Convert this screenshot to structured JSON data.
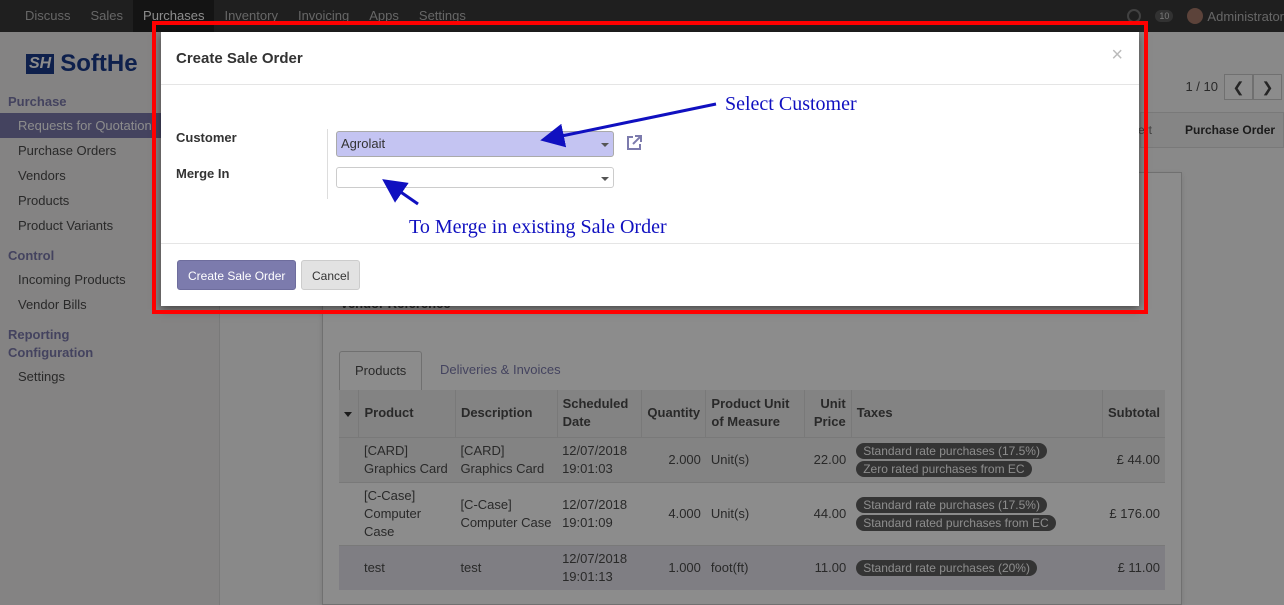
{
  "navbar": {
    "items": [
      {
        "label": "Discuss",
        "active": false
      },
      {
        "label": "Sales",
        "active": false
      },
      {
        "label": "Purchases",
        "active": true
      },
      {
        "label": "Inventory",
        "active": false
      },
      {
        "label": "Invoicing",
        "active": false
      },
      {
        "label": "Apps",
        "active": false
      },
      {
        "label": "Settings",
        "active": false
      }
    ],
    "chat_count": "10",
    "user": "Administrator"
  },
  "sidebar": {
    "logo_text": "SoftHe",
    "sections": [
      {
        "title": "Purchase",
        "items": [
          "Requests for Quotation",
          "Purchase Orders",
          "Vendors",
          "Products",
          "Product Variants"
        ]
      },
      {
        "title": "Control",
        "items": [
          "Incoming Products",
          "Vendor Bills"
        ]
      },
      {
        "title": "Reporting",
        "items": []
      },
      {
        "title": "Configuration",
        "items": [
          "Settings"
        ]
      }
    ],
    "active_item": "Requests for Quotation"
  },
  "main": {
    "pager": "1 / 10",
    "status": [
      "ert",
      "Purchase Order"
    ],
    "vendor_reference_label": "Vendor Reference",
    "tabs": [
      "Products",
      "Deliveries & Invoices"
    ],
    "table": {
      "headers": [
        "Product",
        "Description",
        "Scheduled Date",
        "Quantity",
        "Product Unit of Measure",
        "Unit Price",
        "Taxes",
        "Subtotal"
      ],
      "rows": [
        {
          "product": "[CARD] Graphics Card",
          "description": "[CARD] Graphics Card",
          "date": "12/07/2018 19:01:03",
          "qty": "2.000",
          "uom": "Unit(s)",
          "price": "22.00",
          "taxes": [
            "Standard rate purchases (17.5%)",
            "Zero rated purchases from EC"
          ],
          "subtotal": "£ 44.00"
        },
        {
          "product": "[C-Case] Computer Case",
          "description": "[C-Case] Computer Case",
          "date": "12/07/2018 19:01:09",
          "qty": "4.000",
          "uom": "Unit(s)",
          "price": "44.00",
          "taxes": [
            "Standard rate purchases (17.5%)",
            "Standard rated purchases from EC"
          ],
          "subtotal": "£ 176.00"
        },
        {
          "product": "test",
          "description": "test",
          "date": "12/07/2018 19:01:13",
          "qty": "1.000",
          "uom": "foot(ft)",
          "price": "11.00",
          "taxes": [
            "Standard rate purchases (20%)"
          ],
          "subtotal": "£ 11.00"
        }
      ]
    }
  },
  "dialog": {
    "title": "Create Sale Order",
    "close": "×",
    "customer_label": "Customer",
    "customer_value": "Agrolait",
    "merge_label": "Merge In",
    "merge_value": "",
    "create_button": "Create Sale Order",
    "cancel_button": "Cancel"
  },
  "annotations": {
    "select_customer": "Select Customer",
    "merge_hint": "To Merge in existing Sale Order"
  },
  "colors": {
    "accent": "#7c7bad",
    "navbar": "#3a3a3a",
    "annotation": "#1010c0",
    "frame": "#ff0000"
  }
}
